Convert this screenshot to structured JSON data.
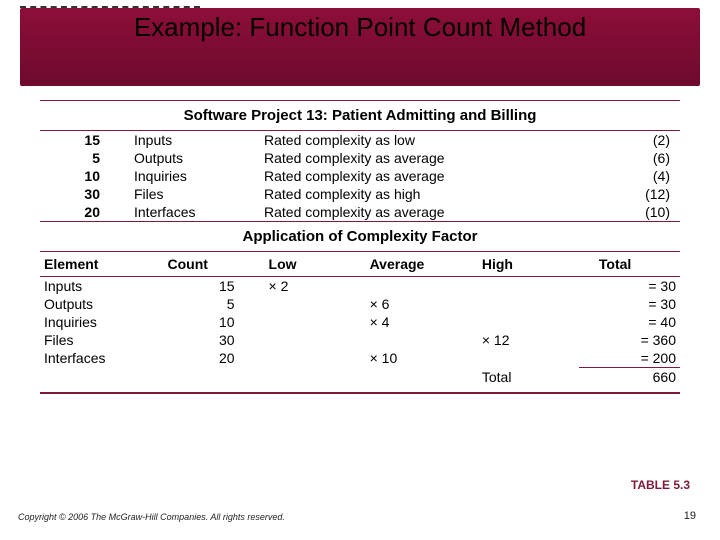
{
  "slide": {
    "title": "Example:  Function Point Count Method",
    "table_label": "TABLE 5.3",
    "copyright": "Copyright © 2006 The McGraw-Hill Companies. All rights reserved.",
    "page_number": "19"
  },
  "section1": {
    "heading": "Software Project 13: Patient Admitting and Billing",
    "rows": [
      {
        "count": "15",
        "type": "Inputs",
        "desc": "Rated complexity as low",
        "wt": "(2)"
      },
      {
        "count": "5",
        "type": "Outputs",
        "desc": "Rated complexity as average",
        "wt": "(6)"
      },
      {
        "count": "10",
        "type": "Inquiries",
        "desc": "Rated complexity as average",
        "wt": "(4)"
      },
      {
        "count": "30",
        "type": "Files",
        "desc": "Rated complexity as high",
        "wt": "(12)"
      },
      {
        "count": "20",
        "type": "Interfaces",
        "desc": "Rated complexity as average",
        "wt": "(10)"
      }
    ]
  },
  "section2": {
    "heading": "Application of Complexity Factor",
    "headers": {
      "element": "Element",
      "count": "Count",
      "low": "Low",
      "average": "Average",
      "high": "High",
      "total": "Total"
    },
    "rows": [
      {
        "element": "Inputs",
        "count": "15",
        "low": "× 2",
        "avg": "",
        "high": "",
        "total": "=   30"
      },
      {
        "element": "Outputs",
        "count": "5",
        "low": "",
        "avg": "× 6",
        "high": "",
        "total": "=   30"
      },
      {
        "element": "Inquiries",
        "count": "10",
        "low": "",
        "avg": "× 4",
        "high": "",
        "total": "=   40"
      },
      {
        "element": "Files",
        "count": "30",
        "low": "",
        "avg": "",
        "high": "× 12",
        "total": "= 360"
      },
      {
        "element": "Interfaces",
        "count": "20",
        "low": "",
        "avg": "× 10",
        "high": "",
        "total": "= 200"
      }
    ],
    "footer": {
      "label": "Total",
      "value": "660"
    }
  },
  "chart_data": {
    "type": "table",
    "title": "Function Point Count — Software Project 13",
    "components": [
      {
        "element": "Inputs",
        "count": 15,
        "complexity": "low",
        "weight": 2,
        "total": 30
      },
      {
        "element": "Outputs",
        "count": 5,
        "complexity": "average",
        "weight": 6,
        "total": 30
      },
      {
        "element": "Inquiries",
        "count": 10,
        "complexity": "average",
        "weight": 4,
        "total": 40
      },
      {
        "element": "Files",
        "count": 30,
        "complexity": "high",
        "weight": 12,
        "total": 360
      },
      {
        "element": "Interfaces",
        "count": 20,
        "complexity": "average",
        "weight": 10,
        "total": 200
      }
    ],
    "grand_total": 660
  }
}
